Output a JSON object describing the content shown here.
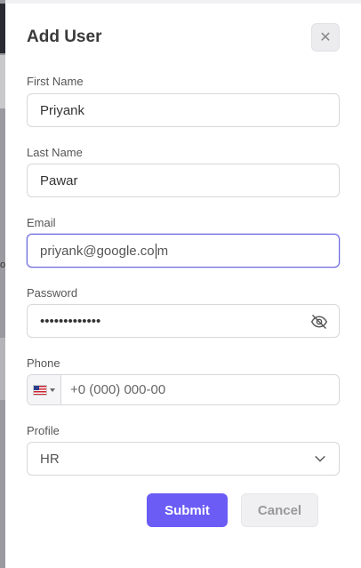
{
  "backdrop": {
    "partial_char": "o"
  },
  "dialog": {
    "title": "Add User",
    "close_symbol": "✕"
  },
  "form": {
    "first_name": {
      "label": "First Name",
      "value": "Priyank"
    },
    "last_name": {
      "label": "Last Name",
      "value": "Pawar"
    },
    "email": {
      "label": "Email",
      "value_before_cursor": "priyank@google.co",
      "value_after_cursor": "m"
    },
    "password": {
      "label": "Password",
      "value": "•••••••••••••",
      "toggle_icon": "eye-slash-icon"
    },
    "phone": {
      "label": "Phone",
      "country_flag": "us-flag-icon",
      "value": "+0 (000) 000-00"
    },
    "profile": {
      "label": "Profile",
      "selected": "HR"
    }
  },
  "actions": {
    "submit_label": "Submit",
    "cancel_label": "Cancel"
  },
  "colors": {
    "accent": "#6a5cf5",
    "focus_border": "#6b66e0",
    "cancel_bg": "#f0f0f2"
  }
}
